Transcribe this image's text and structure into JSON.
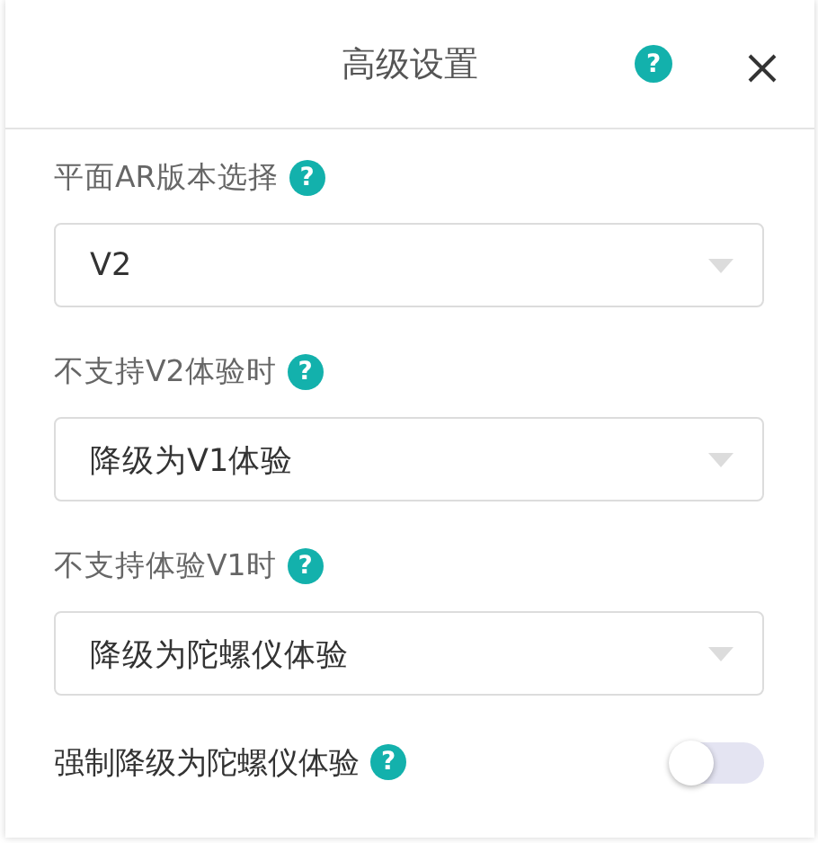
{
  "dialog": {
    "title": "高级设置",
    "help": "?"
  },
  "fields": [
    {
      "kind": "select",
      "label": "平面AR版本选择",
      "help": "?",
      "value": "V2"
    },
    {
      "kind": "select",
      "label": "不支持V2体验时",
      "help": "?",
      "value": "降级为V1体验"
    },
    {
      "kind": "select",
      "label": "不支持体验V1时",
      "help": "?",
      "value": "降级为陀螺仪体验"
    },
    {
      "kind": "toggle",
      "label": "强制降级为陀螺仪体验",
      "help": "?",
      "on": false
    }
  ]
}
